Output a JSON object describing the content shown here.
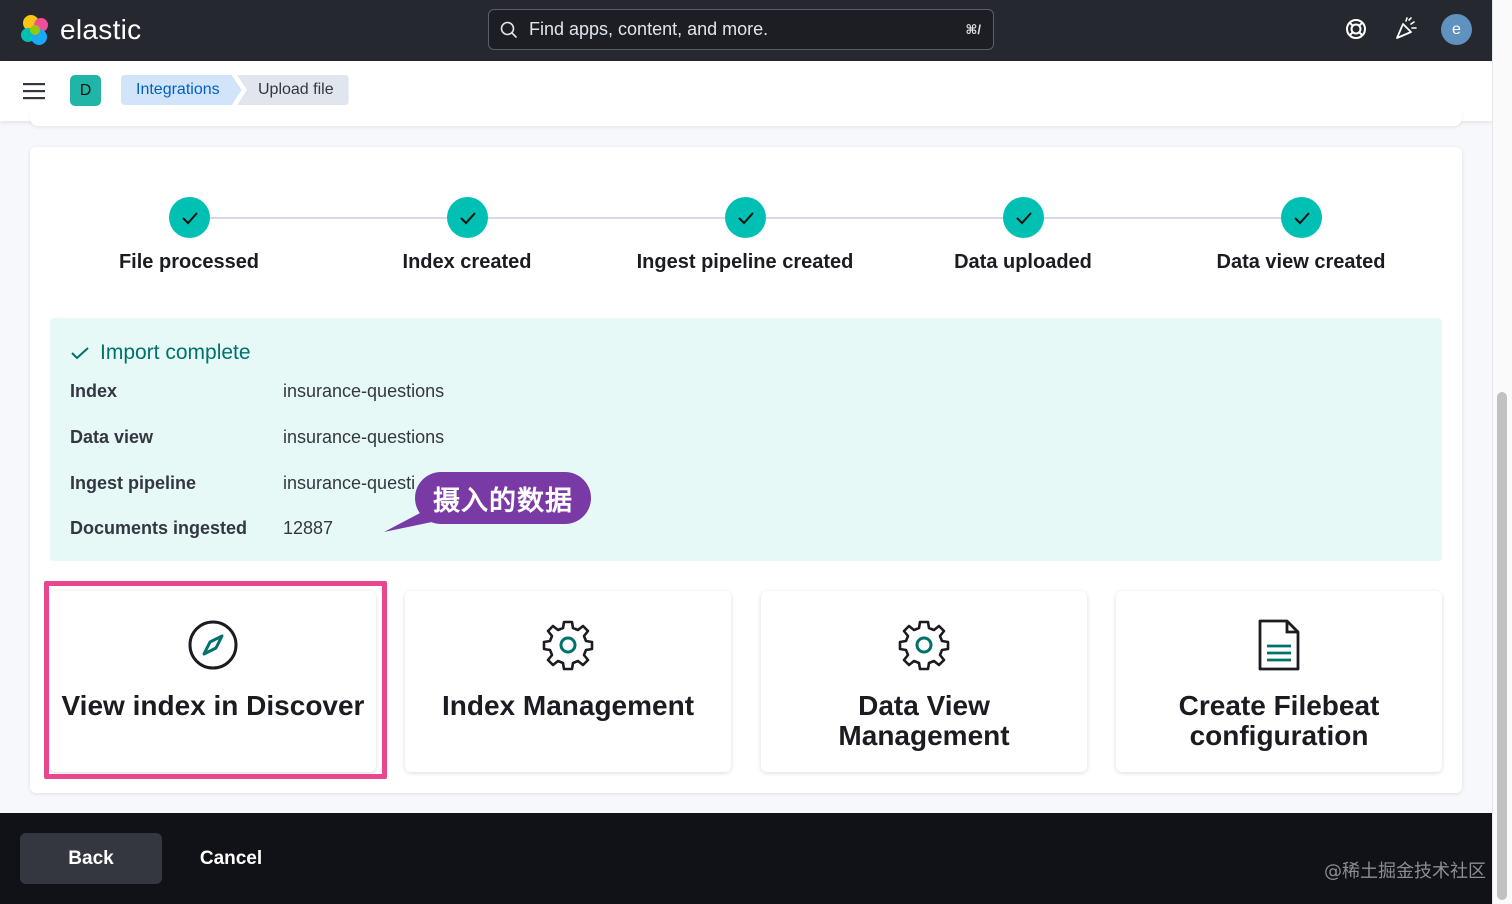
{
  "header": {
    "logo_text": "elastic",
    "search_placeholder": "Find apps, content, and more.",
    "search_shortcut": "⌘/",
    "avatar_initial": "e"
  },
  "nav": {
    "space_initial": "D",
    "breadcrumbs": [
      "Integrations",
      "Upload file"
    ]
  },
  "steps": [
    {
      "label": "File processed",
      "status": "complete"
    },
    {
      "label": "Index created",
      "status": "complete"
    },
    {
      "label": "Ingest pipeline created",
      "status": "complete"
    },
    {
      "label": "Data uploaded",
      "status": "complete"
    },
    {
      "label": "Data view created",
      "status": "complete"
    }
  ],
  "import_result": {
    "title": "Import complete",
    "rows": [
      {
        "key": "Index",
        "value": "insurance-questions"
      },
      {
        "key": "Data view",
        "value": "insurance-questions"
      },
      {
        "key": "Ingest pipeline",
        "value": "insurance-questi"
      },
      {
        "key": "Documents ingested",
        "value": "12887"
      }
    ]
  },
  "annotation": {
    "text": "摄入的数据"
  },
  "cards": [
    {
      "title": "View index in Discover",
      "icon": "compass-icon",
      "highlighted": true
    },
    {
      "title": "Index Management",
      "icon": "gear-icon"
    },
    {
      "title": "Data View Management",
      "icon": "gear-icon"
    },
    {
      "title": "Create Filebeat configuration",
      "icon": "document-icon"
    }
  ],
  "footer": {
    "back_label": "Back",
    "cancel_label": "Cancel",
    "watermark": "@稀土掘金技术社区"
  },
  "colors": {
    "header_bg": "#25282f",
    "accent_teal": "#00bfb3",
    "callout_bg": "#e6f9f7",
    "annotation_bg": "#7a3aa6",
    "highlight_border": "#e8488b"
  }
}
